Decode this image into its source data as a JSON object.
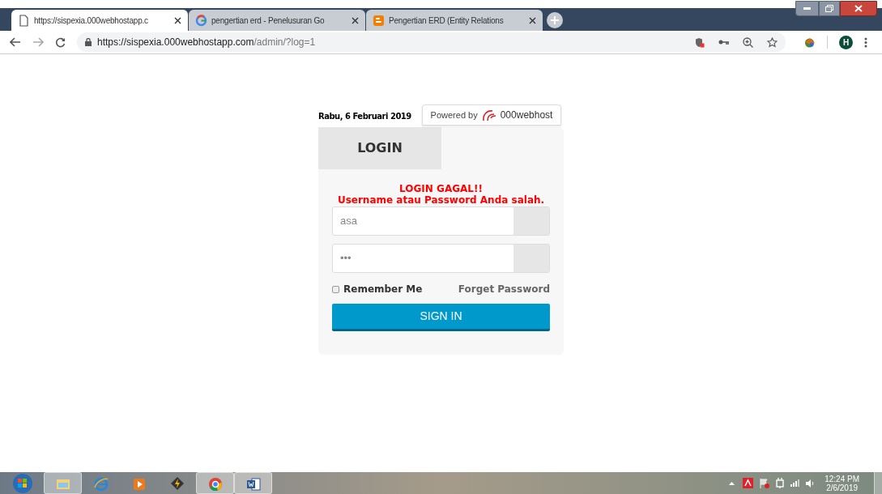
{
  "tabs": [
    {
      "title": "https://sispexia.000webhostapp.c",
      "kind": "page",
      "selected": true
    },
    {
      "title": "pengertian erd - Penelusuran Go",
      "kind": "google",
      "selected": false
    },
    {
      "title": "Pengertian ERD (Entity Relations",
      "kind": "blogger",
      "selected": false
    }
  ],
  "address": {
    "host": "https://sispexia.000webhostapp.com",
    "path": "/admin/?log=1"
  },
  "profile": {
    "initial": "H"
  },
  "page": {
    "date": "Rabu, 6 Februari 2019",
    "powered_by": {
      "prefix": "Powered by",
      "brand": "000webhost"
    },
    "login_tab": "LOGIN",
    "error": [
      "LOGIN GAGAL!!",
      "Username atau Password Anda salah."
    ],
    "username": {
      "value": "asa"
    },
    "password": {
      "value": "•••"
    },
    "remember": {
      "label": "Remember Me",
      "checked": false
    },
    "forgot": "Forget Password",
    "submit": "SIGN IN"
  },
  "taskbar": {
    "apps": [
      {
        "kind": "folder",
        "selected": true
      },
      {
        "kind": "ie",
        "selected": false
      },
      {
        "kind": "media",
        "selected": false
      },
      {
        "kind": "bolt",
        "selected": false
      },
      {
        "kind": "chrome",
        "selected": true
      },
      {
        "kind": "word",
        "selected": true
      }
    ],
    "time": "12:24 PM",
    "date": "2/6/2019"
  }
}
